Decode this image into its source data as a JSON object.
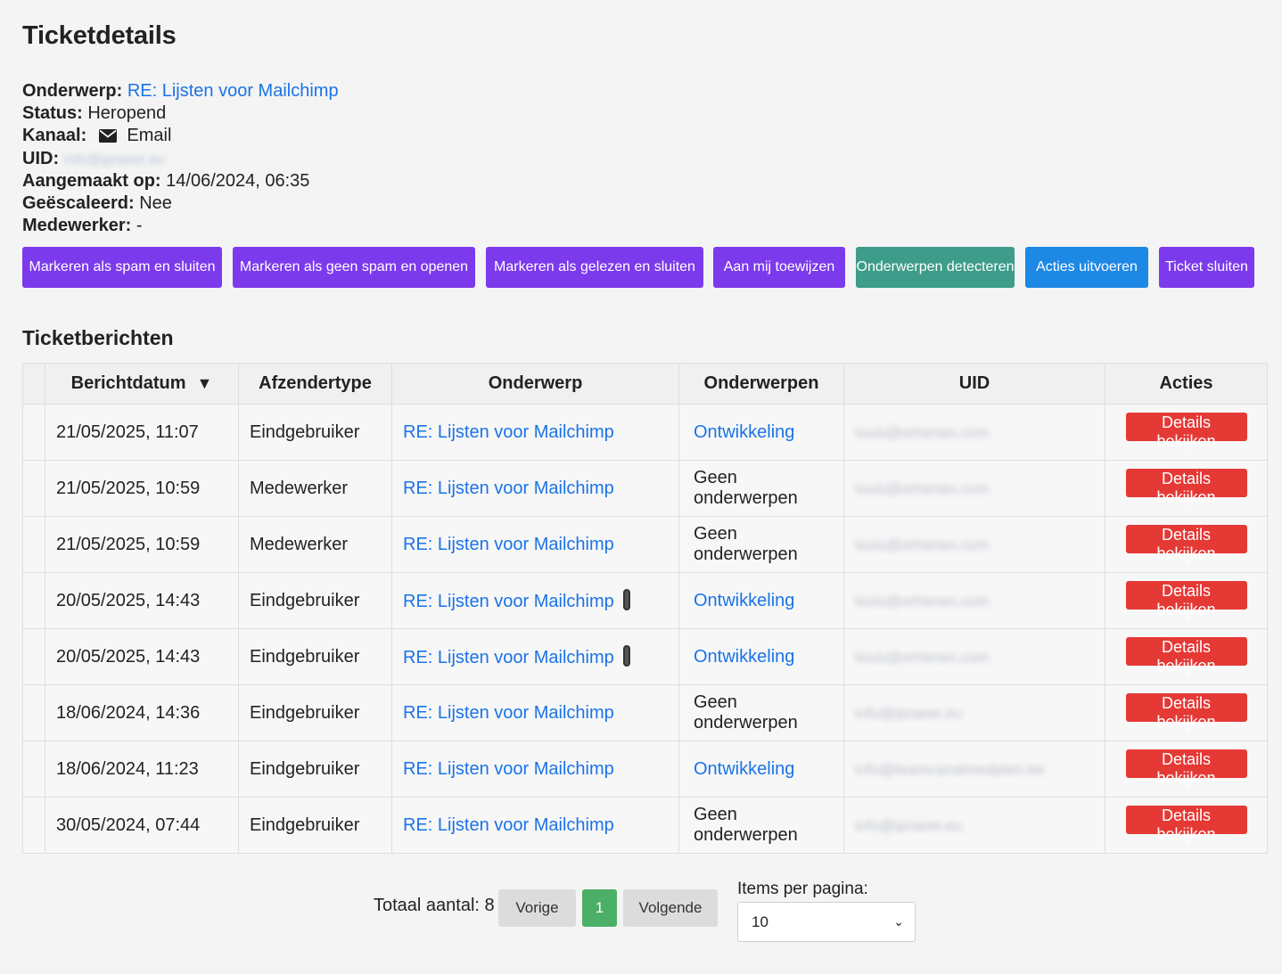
{
  "page": {
    "title": "Ticketdetails",
    "details": {
      "subject_label": "Onderwerp:",
      "subject_value": "RE: Lijsten voor Mailchimp",
      "status_label": "Status:",
      "status_value": "Heropend",
      "channel_label": "Kanaal:",
      "channel_icon": "envelope-icon",
      "channel_value": "Email",
      "uid_label": "UID:",
      "uid_value": "info@ipraeer.eu",
      "created_label": "Aangemaakt op:",
      "created_value": "14/06/2024, 06:35",
      "escalated_label": "Geëscaleerd:",
      "escalated_value": "Nee",
      "agent_label": "Medewerker:",
      "agent_value": "-"
    },
    "actions": {
      "spam_close": "Markeren als spam en sluiten",
      "not_spam_open": "Markeren als geen spam en openen",
      "read_close": "Markeren als gelezen en sluiten",
      "assign_me": "Aan mij toewijzen",
      "detect_topics": "Onderwerpen detecteren",
      "run_actions": "Acties uitvoeren",
      "close_ticket": "Ticket sluiten"
    },
    "colors": {
      "purple": "#7c3aed",
      "teal": "#3d9c8a",
      "blue": "#1e88e5",
      "red": "#e53935",
      "link": "#1a73e8",
      "green": "#4caf68"
    },
    "messages_title": "Ticketberichten",
    "table": {
      "headers": {
        "date": "Berichtdatum",
        "sort_icon": "▼",
        "sender_type": "Afzendertype",
        "subject": "Onderwerp",
        "topics": "Onderwerpen",
        "uid": "UID",
        "actions": "Acties"
      },
      "rows": [
        {
          "date": "21/05/2025, 11:07",
          "sender": "Eindgebruiker",
          "subject": "RE: Lijsten voor Mailchimp",
          "attachment": false,
          "topics": "Ontwikkeling",
          "topics_link": true,
          "uid": "louis@orhenex.com",
          "action": "Details bekijken"
        },
        {
          "date": "21/05/2025, 10:59",
          "sender": "Medewerker",
          "subject": "RE: Lijsten voor Mailchimp",
          "attachment": false,
          "topics": "Geen onderwerpen",
          "topics_link": false,
          "uid": "louis@orhenex.com",
          "action": "Details bekijken"
        },
        {
          "date": "21/05/2025, 10:59",
          "sender": "Medewerker",
          "subject": "RE: Lijsten voor Mailchimp",
          "attachment": false,
          "topics": "Geen onderwerpen",
          "topics_link": false,
          "uid": "louis@orhenex.com",
          "action": "Details bekijken"
        },
        {
          "date": "20/05/2025, 14:43",
          "sender": "Eindgebruiker",
          "subject": "RE: Lijsten voor Mailchimp",
          "attachment": true,
          "topics": "Ontwikkeling",
          "topics_link": true,
          "uid": "louis@orhenex.com",
          "action": "Details bekijken"
        },
        {
          "date": "20/05/2025, 14:43",
          "sender": "Eindgebruiker",
          "subject": "RE: Lijsten voor Mailchimp",
          "attachment": true,
          "topics": "Ontwikkeling",
          "topics_link": true,
          "uid": "louis@orhenex.com",
          "action": "Details bekijken"
        },
        {
          "date": "18/06/2024, 14:36",
          "sender": "Eindgebruiker",
          "subject": "RE: Lijsten voor Mailchimp",
          "attachment": false,
          "topics": "Geen onderwerpen",
          "topics_link": false,
          "uid": "info@ipraeer.eu",
          "action": "Details bekijken"
        },
        {
          "date": "18/06/2024, 11:23",
          "sender": "Eindgebruiker",
          "subject": "RE: Lijsten voor Mailchimp",
          "attachment": false,
          "topics": "Ontwikkeling",
          "topics_link": true,
          "uid": "info@teamcanalmedaten.be",
          "action": "Details bekijken"
        },
        {
          "date": "30/05/2024, 07:44",
          "sender": "Eindgebruiker",
          "subject": "RE: Lijsten voor Mailchimp",
          "attachment": false,
          "topics": "Geen onderwerpen",
          "topics_link": false,
          "uid": "info@ipraeer.eu",
          "action": "Details bekijken"
        }
      ]
    },
    "pagination": {
      "total_label": "Totaal aantal: 8",
      "prev": "Vorige",
      "current": "1",
      "next": "Volgende",
      "per_page_label": "Items per pagina:",
      "per_page_value": "10"
    }
  }
}
